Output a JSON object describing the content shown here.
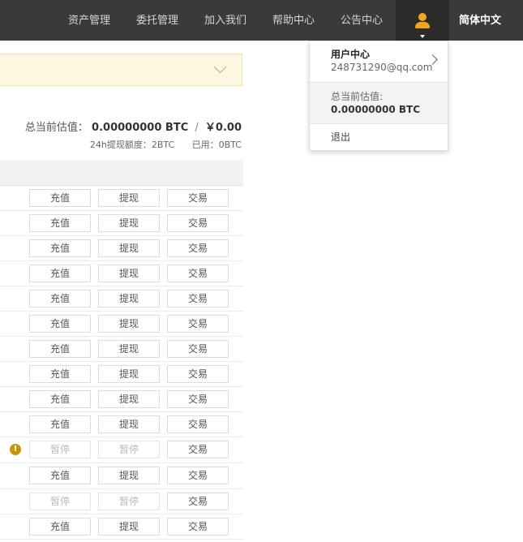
{
  "nav": {
    "items": [
      "资产管理",
      "委托管理",
      "加入我们",
      "帮助中心",
      "公告中心"
    ],
    "language": "简体中文"
  },
  "summary": {
    "total_label": "总当前估值：",
    "total_btc": "0.00000000 BTC",
    "separator": "/",
    "total_cny": "￥0.00",
    "withdraw_limit": "24h提现额度：2BTC",
    "used": "已用：0BTC"
  },
  "user_menu": {
    "title": "用户中心",
    "email": "248731290@qq.com",
    "total_label": "总当前估值:",
    "total_value": "0.00000000 BTC",
    "logout": "退出"
  },
  "table": {
    "rows": [
      {
        "deposit": "充值",
        "withdraw": "提现",
        "trade": "交易",
        "suspended": false,
        "warning": false
      },
      {
        "deposit": "充值",
        "withdraw": "提现",
        "trade": "交易",
        "suspended": false,
        "warning": false
      },
      {
        "deposit": "充值",
        "withdraw": "提现",
        "trade": "交易",
        "suspended": false,
        "warning": false
      },
      {
        "deposit": "充值",
        "withdraw": "提现",
        "trade": "交易",
        "suspended": false,
        "warning": false
      },
      {
        "deposit": "充值",
        "withdraw": "提现",
        "trade": "交易",
        "suspended": false,
        "warning": false
      },
      {
        "deposit": "充值",
        "withdraw": "提现",
        "trade": "交易",
        "suspended": false,
        "warning": false
      },
      {
        "deposit": "充值",
        "withdraw": "提现",
        "trade": "交易",
        "suspended": false,
        "warning": false
      },
      {
        "deposit": "充值",
        "withdraw": "提现",
        "trade": "交易",
        "suspended": false,
        "warning": false
      },
      {
        "deposit": "充值",
        "withdraw": "提现",
        "trade": "交易",
        "suspended": false,
        "warning": false
      },
      {
        "deposit": "充值",
        "withdraw": "提现",
        "trade": "交易",
        "suspended": false,
        "warning": false
      },
      {
        "deposit": "暂停",
        "withdraw": "暂停",
        "trade": "交易",
        "suspended": true,
        "warning": true,
        "warning_glyph": "!"
      },
      {
        "deposit": "充值",
        "withdraw": "提现",
        "trade": "交易",
        "suspended": false,
        "warning": false
      },
      {
        "deposit": "暂停",
        "withdraw": "暂停",
        "trade": "交易",
        "suspended": true,
        "warning": false
      },
      {
        "deposit": "充值",
        "withdraw": "提现",
        "trade": "交易",
        "suspended": false,
        "warning": false
      }
    ]
  },
  "colors": {
    "topbar": "#3a3a3a",
    "accent": "#f2a71b",
    "select_bar": "#fdf6e1",
    "warning": "#c8960c"
  },
  "icons": {
    "user": "user-icon",
    "select": "chevron-down-icon",
    "user_menu_arrow": "chevron-right-icon",
    "warning": "warning-icon"
  }
}
